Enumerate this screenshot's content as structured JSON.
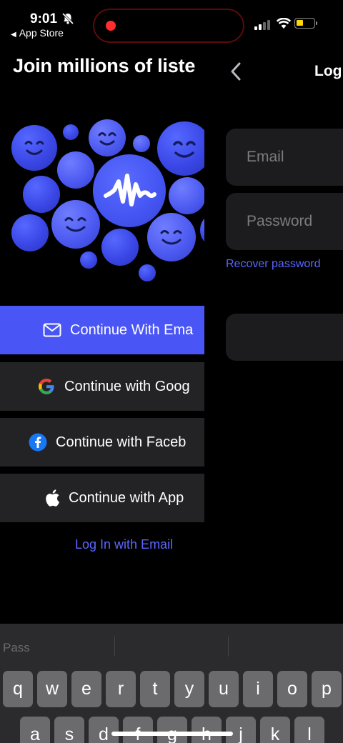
{
  "status_bar": {
    "time": "9:01",
    "back_app": "App Store",
    "icons": [
      "bell-slash-icon",
      "record-dot-icon",
      "cellular-signal-icon",
      "wifi-icon",
      "battery-icon"
    ],
    "record_color": "#ff2d2d",
    "battery_color": "#ffd60a"
  },
  "left": {
    "heading": "Join millions of liste",
    "buttons": [
      {
        "label": "Continue With Ema",
        "icon": "envelope-icon"
      },
      {
        "label": "Continue with Goog",
        "icon": "google-icon"
      },
      {
        "label": "Continue with Faceb",
        "icon": "facebook-icon"
      },
      {
        "label": "Continue with App",
        "icon": "apple-icon"
      }
    ],
    "login_link": "Log In with Email"
  },
  "right": {
    "title": "Log",
    "email_placeholder": "Email",
    "password_placeholder": "Password",
    "recover": "Recover password"
  },
  "keyboard": {
    "suggestion": "Pass",
    "row1": [
      "q",
      "w",
      "e",
      "r",
      "t",
      "y",
      "u",
      "i",
      "o",
      "p"
    ],
    "row2": [
      "a",
      "s",
      "d",
      "f",
      "g",
      "h",
      "j",
      "k",
      "l"
    ]
  },
  "colors": {
    "accent": "#4a55f5",
    "link": "#5b66ff",
    "button_bg": "#232325",
    "field_bg": "#1c1c1e"
  }
}
